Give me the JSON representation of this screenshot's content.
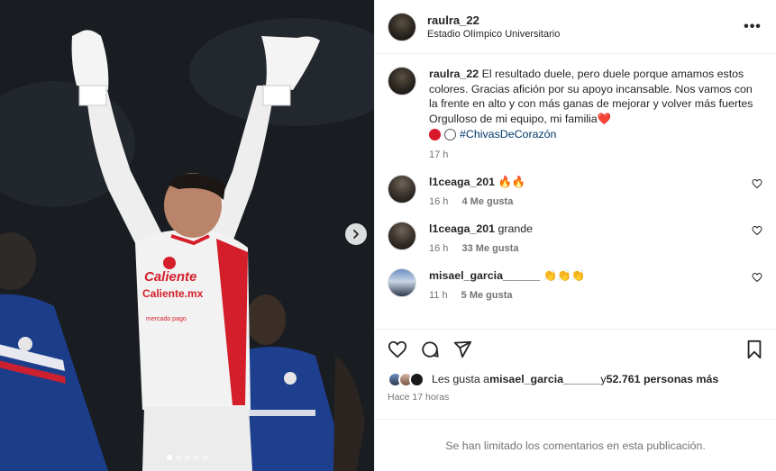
{
  "post": {
    "username": "raulra_22",
    "location": "Estadio Olímpico Universitario",
    "more_label": "•••",
    "caption_user": "raulra_22",
    "caption_text": "El resultado duele, pero duele porque amamos estos colores. Gracias afición por su apoyo incansable. Nos vamos con la frente en alto y con más ganas de mejorar y volver más fuertes Orgulloso de mi equipo, mi familia❤️",
    "hashtag": "#ChivasDeCorazón",
    "caption_time": "17 h"
  },
  "photo": {
    "jersey_text_1": "Caliente",
    "jersey_text_2": "Caliente.mx",
    "jersey_text_3": "mercado pago",
    "carousel_dots": 5,
    "active_dot": 1
  },
  "comments": [
    {
      "user": "l1ceaga_201",
      "text": "🔥🔥",
      "time": "16 h",
      "likes": "4 Me gusta"
    },
    {
      "user": "l1ceaga_201",
      "text": "grande",
      "time": "16 h",
      "likes": "33 Me gusta"
    },
    {
      "user": "misael_garcia______",
      "text": "👏👏👏",
      "time": "11 h",
      "likes": "5 Me gusta"
    }
  ],
  "likes": {
    "prefix": "Les gusta a ",
    "user": "misael_garcia______",
    "middle": " y ",
    "count": "52.761 personas más"
  },
  "time_ago": "Hace 17 horas",
  "comments_limited": "Se han limitado los comentarios en esta publicación.",
  "colors": {
    "accent_red": "#d8172a",
    "hashtag_blue": "#00376b",
    "muted": "#737373"
  },
  "icons": [
    "next-arrow-icon",
    "more-icon",
    "heart-icon",
    "comment-icon",
    "share-icon",
    "bookmark-icon"
  ]
}
